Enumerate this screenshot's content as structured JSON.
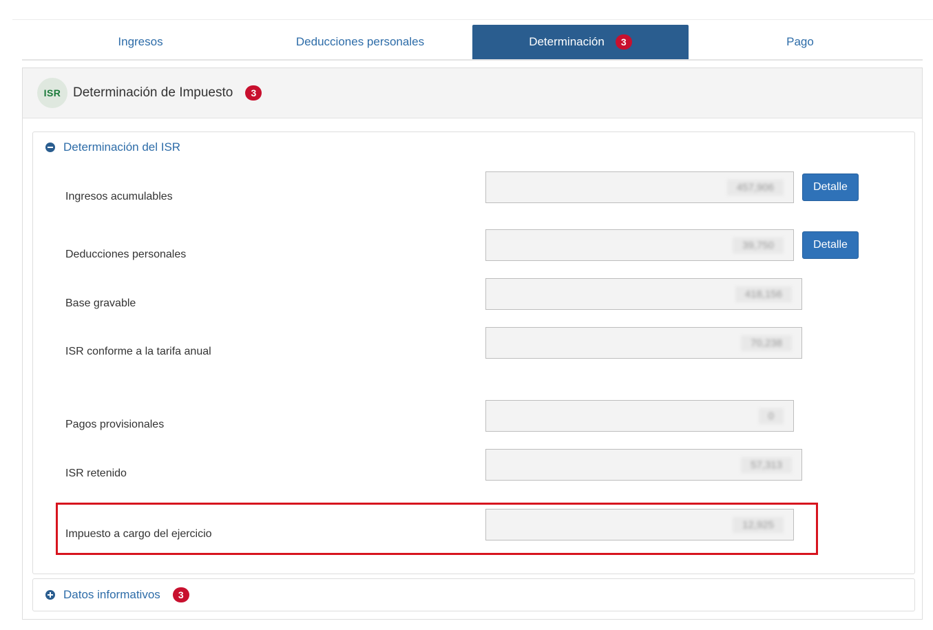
{
  "tabs": [
    {
      "label": "Ingresos"
    },
    {
      "label": "Deducciones personales"
    },
    {
      "label": "Determinación",
      "badge": "3",
      "active": true
    },
    {
      "label": "Pago"
    }
  ],
  "panel": {
    "icon_text": "ISR",
    "title": "Determinación de Impuesto",
    "badge": "3"
  },
  "section_isr": {
    "title": "Determinación del ISR",
    "rows": [
      {
        "label": "Ingresos acumulables",
        "value": "457,906",
        "button": "Detalle"
      },
      {
        "label": "Deducciones personales",
        "value": "39,750",
        "button": "Detalle"
      },
      {
        "label": "Base gravable",
        "value": "418,156"
      },
      {
        "label": "ISR conforme a la tarifa anual",
        "value": "70,238"
      },
      {
        "label": "Pagos provisionales",
        "value": "0"
      },
      {
        "label": "ISR retenido",
        "value": "57,313"
      },
      {
        "label": "Impuesto a cargo del ejercicio",
        "value": "12,925"
      }
    ]
  },
  "section_info": {
    "title": "Datos informativos",
    "badge": "3"
  },
  "colors": {
    "active_tab": "#2a5d8f",
    "link": "#2d6ca8",
    "badge": "#c8102e",
    "button": "#2f72b8",
    "highlight_border": "#d7141e"
  }
}
